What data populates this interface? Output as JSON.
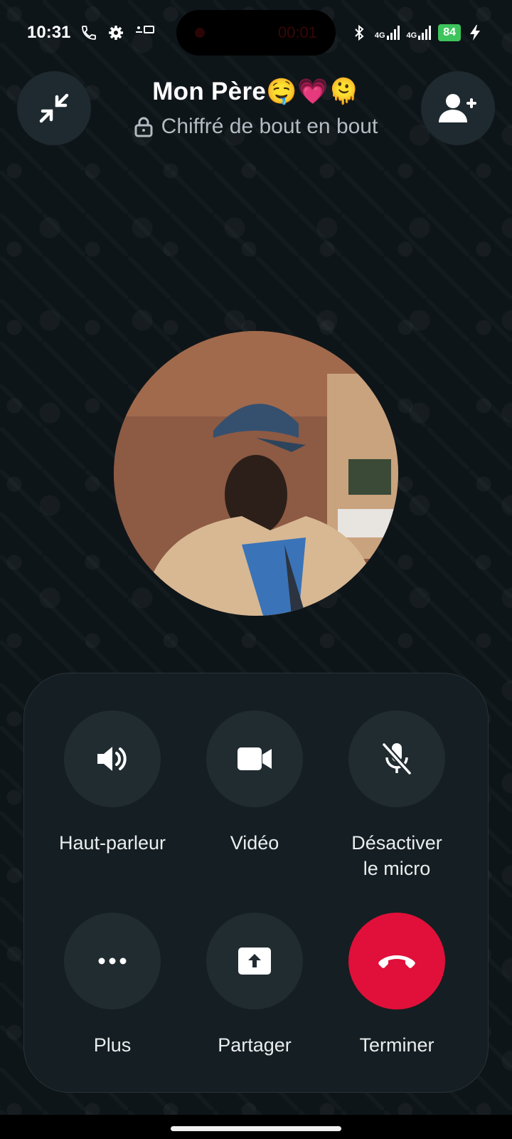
{
  "status_bar": {
    "time": "10:31",
    "network_1": "4G",
    "network_2": "4G",
    "battery": "84"
  },
  "call_pill": {
    "timer": "00:01"
  },
  "header": {
    "contact_name": "Mon Père🤤💗🫠",
    "encryption_text": "Chiffré de bout en bout"
  },
  "controls": {
    "speaker_label": "Haut-parleur",
    "video_label": "Vidéo",
    "mute_label_line1": "Désactiver",
    "mute_label_line2": "le micro",
    "more_label": "Plus",
    "share_label": "Partager",
    "end_label": "Terminer"
  },
  "colors": {
    "background": "#0d1418",
    "panel": "#151e22",
    "button": "#212c31",
    "end_call": "#e0103a",
    "battery": "#3ec45c"
  }
}
